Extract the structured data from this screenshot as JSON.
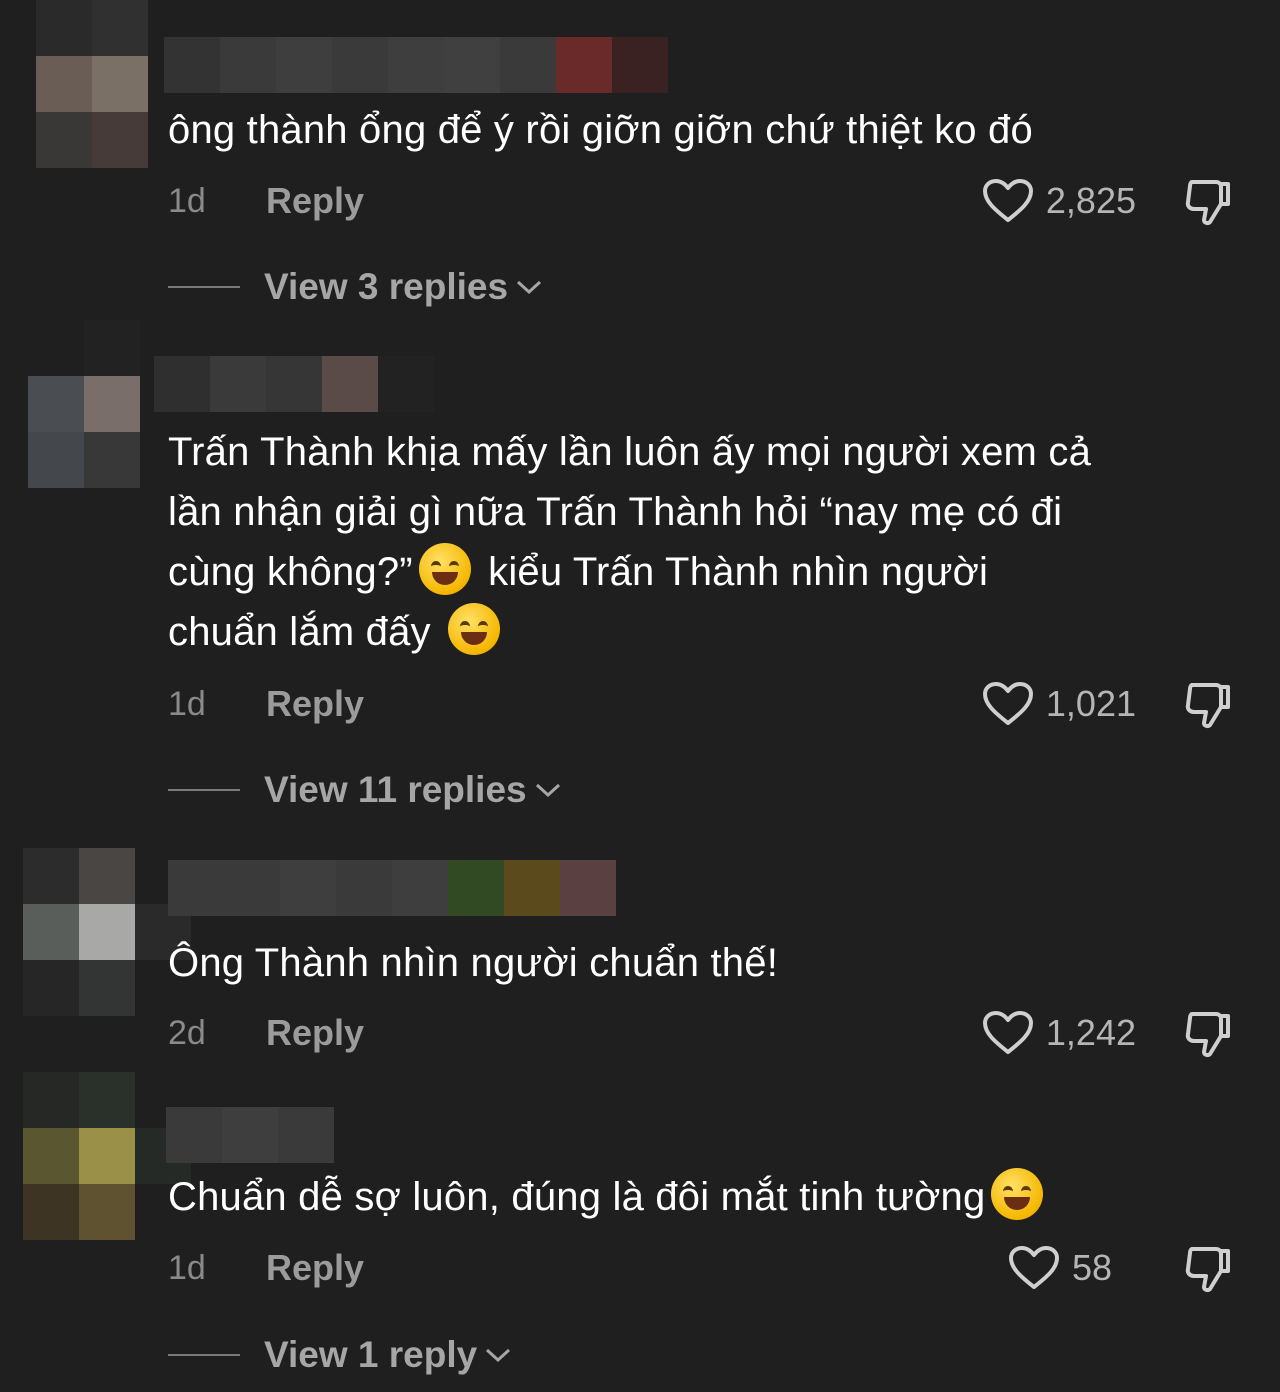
{
  "icons": {
    "like": "heart-outline-icon",
    "dislike": "thumbs-down-icon",
    "expand": "chevron-down-icon"
  },
  "comments": [
    {
      "text": "ông thành ổng để ý rồi giỡn giỡn chứ thiệt ko đó",
      "time": "1d",
      "reply_label": "Reply",
      "likes": "2,825",
      "view_replies": "View 3 replies",
      "avatar_colors": [
        "#2a2a2a",
        "#303030",
        "#1f1f1f",
        "#6a5d55",
        "#7a7065",
        "#1f1f1f",
        "#3a3837",
        "#473b39",
        "#1f1f1f"
      ],
      "name_colors": [
        "#333333",
        "#3a3a3a",
        "#3e3e3e",
        "#3a3a3a",
        "#3e3e3e",
        "#404040",
        "#3a3a3a",
        "#6b2a2a",
        "#3b2222"
      ]
    },
    {
      "text_lines": [
        "Trấn Thành khịa mấy lần luôn ấy mọi người xem cả",
        "lần nhận giải gì nữa Trấn Thành hỏi “nay mẹ có đi",
        "cùng không?”",
        "kiểu Trấn Thành nhìn người",
        "chuẩn lắm đấy"
      ],
      "time": "1d",
      "reply_label": "Reply",
      "likes": "1,021",
      "view_replies": "View 11 replies",
      "avatar_colors": [
        "#1f1f1f",
        "#222222",
        "#1f1f1f",
        "#4a4e52",
        "#7a6e6a",
        "#1f1f1f",
        "#44484c",
        "#383838",
        "#1f1f1f"
      ],
      "name_colors": [
        "#2f2f2f",
        "#3a3a3a",
        "#363636",
        "#5a4a48",
        "#222222"
      ]
    },
    {
      "text": "Ông Thành nhìn người chuẩn thế!",
      "time": "2d",
      "reply_label": "Reply",
      "likes": "1,242",
      "avatar_colors": [
        "#2c2c2c",
        "#4a4644",
        "#1f1f1f",
        "#5a5e5a",
        "#a8a8a6",
        "#2a2a2a",
        "#262626",
        "#333535",
        "#1f1f1f"
      ],
      "name_colors": [
        "#3a3a3a",
        "#3a3a3a",
        "#3e3e3e",
        "#3a3a3a",
        "#3e3e3e",
        "#324a24",
        "#5a4a1c",
        "#5a4040"
      ]
    },
    {
      "text": "Chuẩn dễ sợ luôn, đúng là đôi mắt tinh tường",
      "time": "1d",
      "reply_label": "Reply",
      "likes": "58",
      "view_replies": "View 1 reply",
      "avatar_colors": [
        "#262826",
        "#2a302a",
        "#1f1f1f",
        "#5a5630",
        "#9a9048",
        "#262a26",
        "#3e3424",
        "#5e5230",
        "#1f1f1f"
      ],
      "name_colors": [
        "#3a3a3a",
        "#3e3e3e",
        "#3a3a3a"
      ]
    }
  ]
}
